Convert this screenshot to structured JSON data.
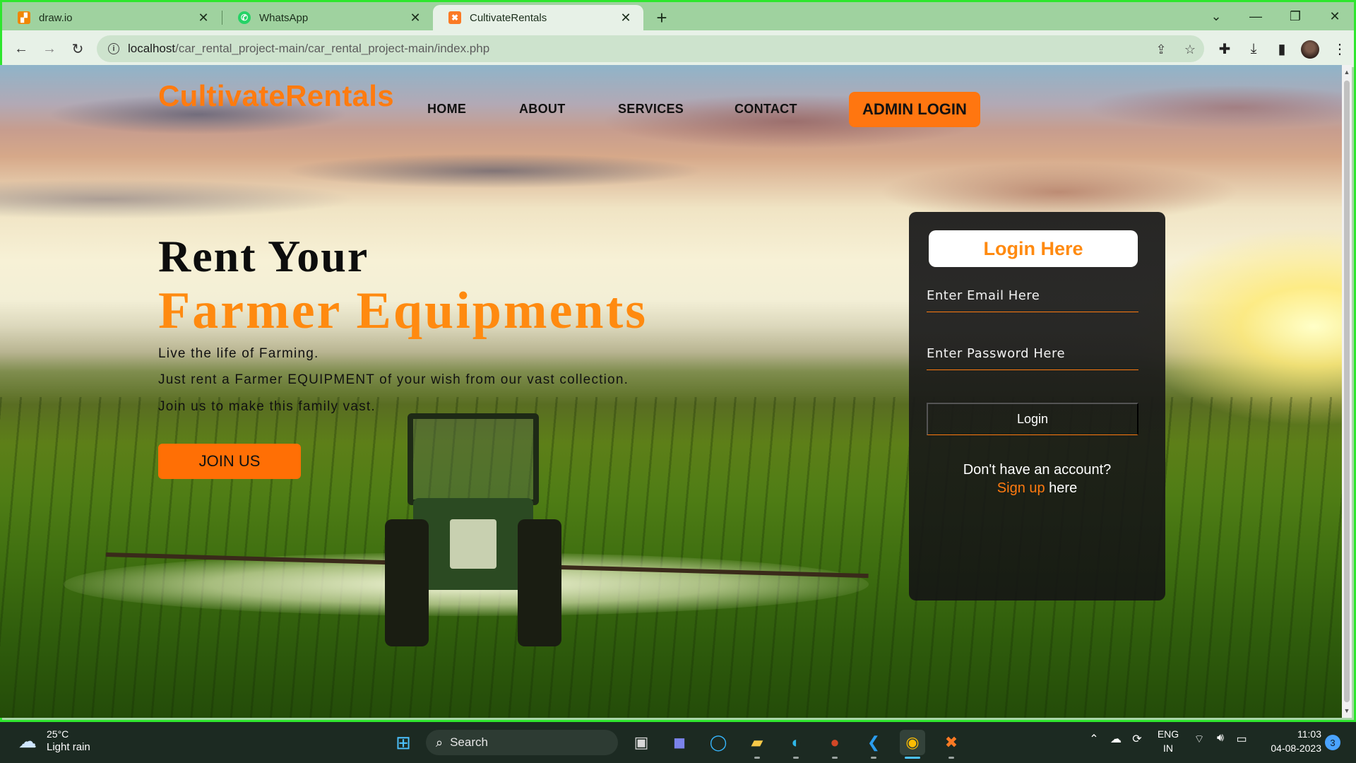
{
  "browser": {
    "tabs": [
      {
        "title": "draw.io",
        "icon": "drawio-icon",
        "color": "#f08705"
      },
      {
        "title": "WhatsApp",
        "icon": "whatsapp-icon",
        "color": "#25d366"
      },
      {
        "title": "CultivateRentals",
        "icon": "xampp-icon",
        "color": "#fb7a24",
        "active": true
      }
    ],
    "url_host": "localhost",
    "url_path": "/car_rental_project-main/car_rental_project-main/index.php"
  },
  "site": {
    "logo": "CultivateRentals",
    "nav": [
      "HOME",
      "ABOUT",
      "SERVICES",
      "CONTACT"
    ],
    "admin_button": "ADMIN LOGIN"
  },
  "hero": {
    "line1": "Rent Your",
    "line2": "Farmer Equipments",
    "paragraphs": [
      "Live the life of Farming.",
      "Just rent a Farmer EQUIPMENT of your wish from our vast collection.",
      "Join us to make this family vast."
    ],
    "join_button": "JOIN US"
  },
  "login": {
    "title": "Login Here",
    "email_placeholder": "Enter Email Here",
    "password_placeholder": "Enter Password Here",
    "login_button": "Login",
    "signup_prompt": "Don't have an account?",
    "signup_link": "Sign up",
    "signup_suffix": " here"
  },
  "taskbar": {
    "weather_temp": "25°C",
    "weather_desc": "Light rain",
    "search_label": "Search",
    "lang_line1": "ENG",
    "lang_line2": "IN",
    "time": "11:03",
    "date": "04-08-2023",
    "notification_count": "3"
  },
  "colors": {
    "accent": "#ff7b0f",
    "window_border": "#2ee62e"
  }
}
